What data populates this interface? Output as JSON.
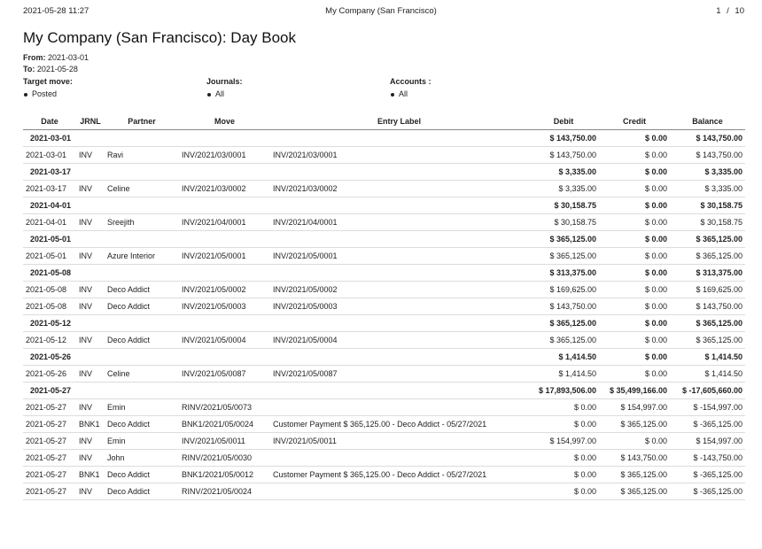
{
  "header": {
    "datetime": "2021-05-28 11:27",
    "company": "My Company (San Francisco)",
    "page_current": "1",
    "page_sep": "/",
    "page_total": "10"
  },
  "title": "My Company (San Francisco): Day Book",
  "from_label": "From:",
  "from_value": "2021-03-01",
  "to_label": "To:",
  "to_value": "2021-05-28",
  "filters": {
    "target_move_label": "Target move:",
    "target_move_value": "Posted",
    "journals_label": "Journals:",
    "journals_value": "All",
    "accounts_label": "Accounts :",
    "accounts_value": "All"
  },
  "columns": {
    "date": "Date",
    "journal": "JRNL",
    "partner": "Partner",
    "move": "Move",
    "label": "Entry Label",
    "debit": "Debit",
    "credit": "Credit",
    "balance": "Balance"
  },
  "groups": [
    {
      "date": "2021-03-01",
      "debit": "$ 143,750.00",
      "credit": "$ 0.00",
      "balance": "$ 143,750.00",
      "rows": [
        {
          "date": "2021-03-01",
          "journal": "INV",
          "partner": "Ravi",
          "move": "INV/2021/03/0001",
          "label": "INV/2021/03/0001",
          "debit": "$ 143,750.00",
          "credit": "$ 0.00",
          "balance": "$ 143,750.00"
        }
      ]
    },
    {
      "date": "2021-03-17",
      "debit": "$ 3,335.00",
      "credit": "$ 0.00",
      "balance": "$ 3,335.00",
      "rows": [
        {
          "date": "2021-03-17",
          "journal": "INV",
          "partner": "Celine",
          "move": "INV/2021/03/0002",
          "label": "INV/2021/03/0002",
          "debit": "$ 3,335.00",
          "credit": "$ 0.00",
          "balance": "$ 3,335.00"
        }
      ]
    },
    {
      "date": "2021-04-01",
      "debit": "$ 30,158.75",
      "credit": "$ 0.00",
      "balance": "$ 30,158.75",
      "rows": [
        {
          "date": "2021-04-01",
          "journal": "INV",
          "partner": "Sreejith",
          "move": "INV/2021/04/0001",
          "label": "INV/2021/04/0001",
          "debit": "$ 30,158.75",
          "credit": "$ 0.00",
          "balance": "$ 30,158.75"
        }
      ]
    },
    {
      "date": "2021-05-01",
      "debit": "$ 365,125.00",
      "credit": "$ 0.00",
      "balance": "$ 365,125.00",
      "rows": [
        {
          "date": "2021-05-01",
          "journal": "INV",
          "partner": "Azure Interior",
          "move": "INV/2021/05/0001",
          "label": "INV/2021/05/0001",
          "debit": "$ 365,125.00",
          "credit": "$ 0.00",
          "balance": "$ 365,125.00"
        }
      ]
    },
    {
      "date": "2021-05-08",
      "debit": "$ 313,375.00",
      "credit": "$ 0.00",
      "balance": "$ 313,375.00",
      "rows": [
        {
          "date": "2021-05-08",
          "journal": "INV",
          "partner": "Deco Addict",
          "move": "INV/2021/05/0002",
          "label": "INV/2021/05/0002",
          "debit": "$ 169,625.00",
          "credit": "$ 0.00",
          "balance": "$ 169,625.00"
        },
        {
          "date": "2021-05-08",
          "journal": "INV",
          "partner": "Deco Addict",
          "move": "INV/2021/05/0003",
          "label": "INV/2021/05/0003",
          "debit": "$ 143,750.00",
          "credit": "$ 0.00",
          "balance": "$ 143,750.00"
        }
      ]
    },
    {
      "date": "2021-05-12",
      "debit": "$ 365,125.00",
      "credit": "$ 0.00",
      "balance": "$ 365,125.00",
      "rows": [
        {
          "date": "2021-05-12",
          "journal": "INV",
          "partner": "Deco Addict",
          "move": "INV/2021/05/0004",
          "label": "INV/2021/05/0004",
          "debit": "$ 365,125.00",
          "credit": "$ 0.00",
          "balance": "$ 365,125.00"
        }
      ]
    },
    {
      "date": "2021-05-26",
      "debit": "$ 1,414.50",
      "credit": "$ 0.00",
      "balance": "$ 1,414.50",
      "rows": [
        {
          "date": "2021-05-26",
          "journal": "INV",
          "partner": "Celine",
          "move": "INV/2021/05/0087",
          "label": "INV/2021/05/0087",
          "debit": "$ 1,414.50",
          "credit": "$ 0.00",
          "balance": "$ 1,414.50"
        }
      ]
    },
    {
      "date": "2021-05-27",
      "debit": "$ 17,893,506.00",
      "credit": "$ 35,499,166.00",
      "balance": "$ -17,605,660.00",
      "rows": [
        {
          "date": "2021-05-27",
          "journal": "INV",
          "partner": "Emin",
          "move": "RINV/2021/05/0073",
          "label": "",
          "debit": "$ 0.00",
          "credit": "$ 154,997.00",
          "balance": "$ -154,997.00"
        },
        {
          "date": "2021-05-27",
          "journal": "BNK1",
          "partner": "Deco Addict",
          "move": "BNK1/2021/05/0024",
          "label": "Customer Payment $ 365,125.00 - Deco Addict - 05/27/2021",
          "debit": "$ 0.00",
          "credit": "$ 365,125.00",
          "balance": "$ -365,125.00"
        },
        {
          "date": "2021-05-27",
          "journal": "INV",
          "partner": "Emin",
          "move": "INV/2021/05/0011",
          "label": "INV/2021/05/0011",
          "debit": "$ 154,997.00",
          "credit": "$ 0.00",
          "balance": "$ 154,997.00"
        },
        {
          "date": "2021-05-27",
          "journal": "INV",
          "partner": "John",
          "move": "RINV/2021/05/0030",
          "label": "",
          "debit": "$ 0.00",
          "credit": "$ 143,750.00",
          "balance": "$ -143,750.00"
        },
        {
          "date": "2021-05-27",
          "journal": "BNK1",
          "partner": "Deco Addict",
          "move": "BNK1/2021/05/0012",
          "label": "Customer Payment $ 365,125.00 - Deco Addict - 05/27/2021",
          "debit": "$ 0.00",
          "credit": "$ 365,125.00",
          "balance": "$ -365,125.00"
        },
        {
          "date": "2021-05-27",
          "journal": "INV",
          "partner": "Deco Addict",
          "move": "RINV/2021/05/0024",
          "label": "",
          "debit": "$ 0.00",
          "credit": "$ 365,125.00",
          "balance": "$ -365,125.00"
        }
      ]
    }
  ]
}
